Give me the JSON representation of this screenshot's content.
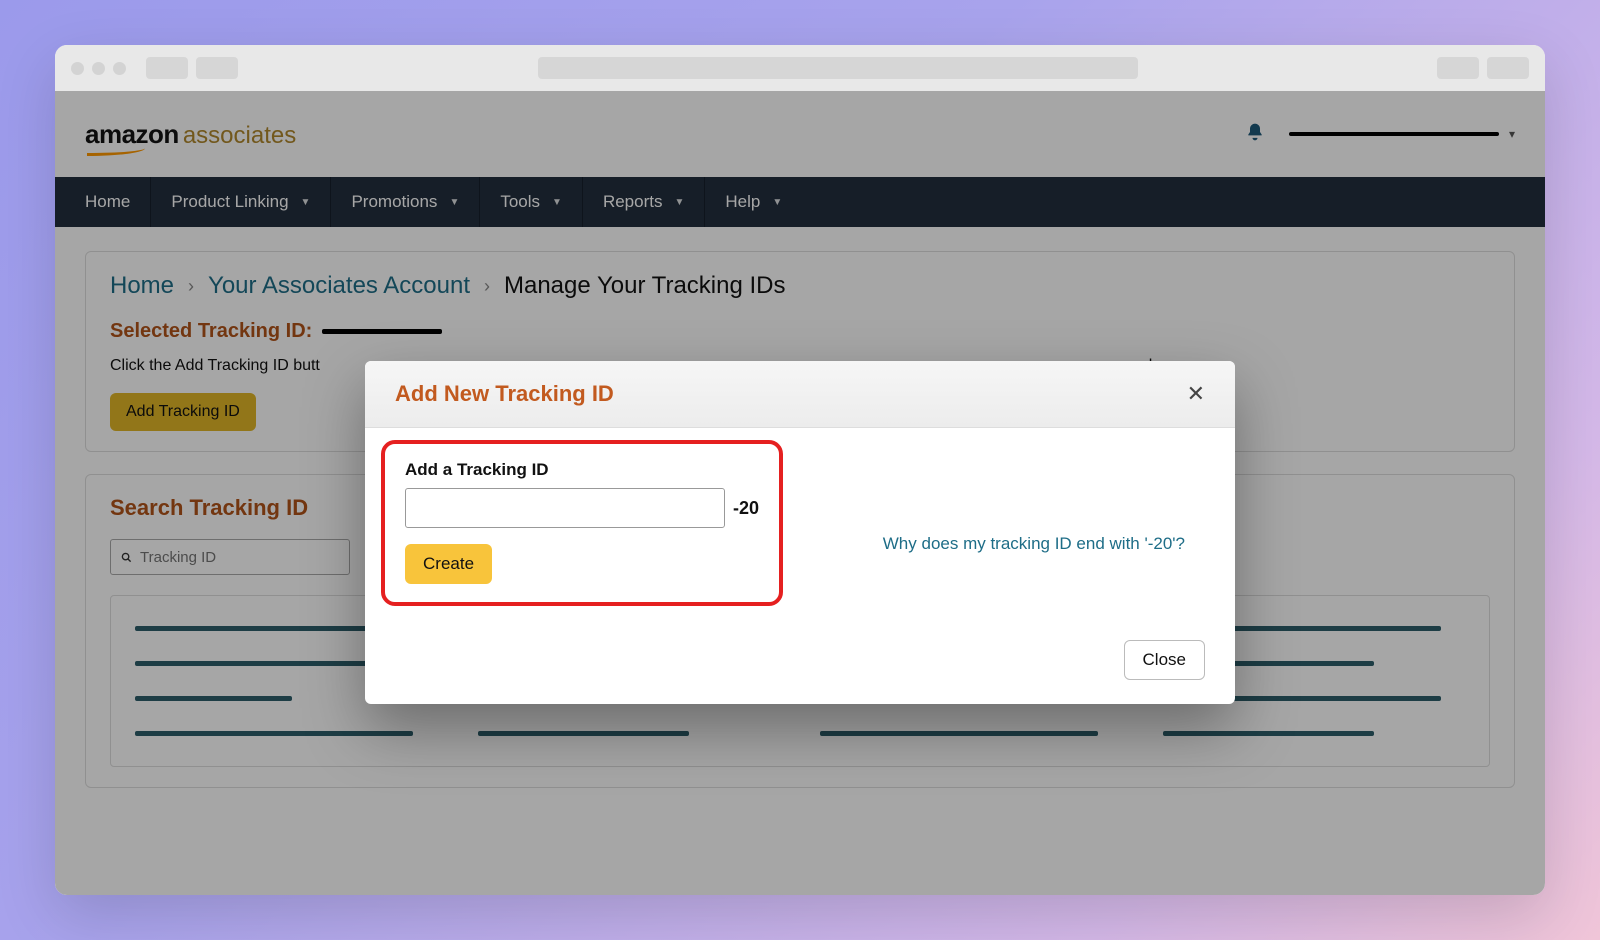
{
  "logo": {
    "brand": "amazon",
    "sub": "associates"
  },
  "nav": {
    "items": [
      {
        "label": "Home",
        "dropdown": false
      },
      {
        "label": "Product Linking",
        "dropdown": true
      },
      {
        "label": "Promotions",
        "dropdown": true
      },
      {
        "label": "Tools",
        "dropdown": true
      },
      {
        "label": "Reports",
        "dropdown": true
      },
      {
        "label": "Help",
        "dropdown": true
      }
    ]
  },
  "breadcrumb": {
    "home": "Home",
    "account": "Your Associates Account",
    "current": "Manage Your Tracking IDs"
  },
  "selected": {
    "label": "Selected Tracking ID:",
    "instruction_prefix": "Click the Add Tracking ID butt",
    "instruction_suffix": "k.",
    "add_button": "Add Tracking ID"
  },
  "search": {
    "title": "Search Tracking ID",
    "placeholder": "Tracking ID"
  },
  "modal": {
    "title": "Add New Tracking ID",
    "field_label": "Add a Tracking ID",
    "suffix": "-20",
    "create": "Create",
    "help": "Why does my tracking ID end with '-20'?",
    "close": "Close"
  }
}
